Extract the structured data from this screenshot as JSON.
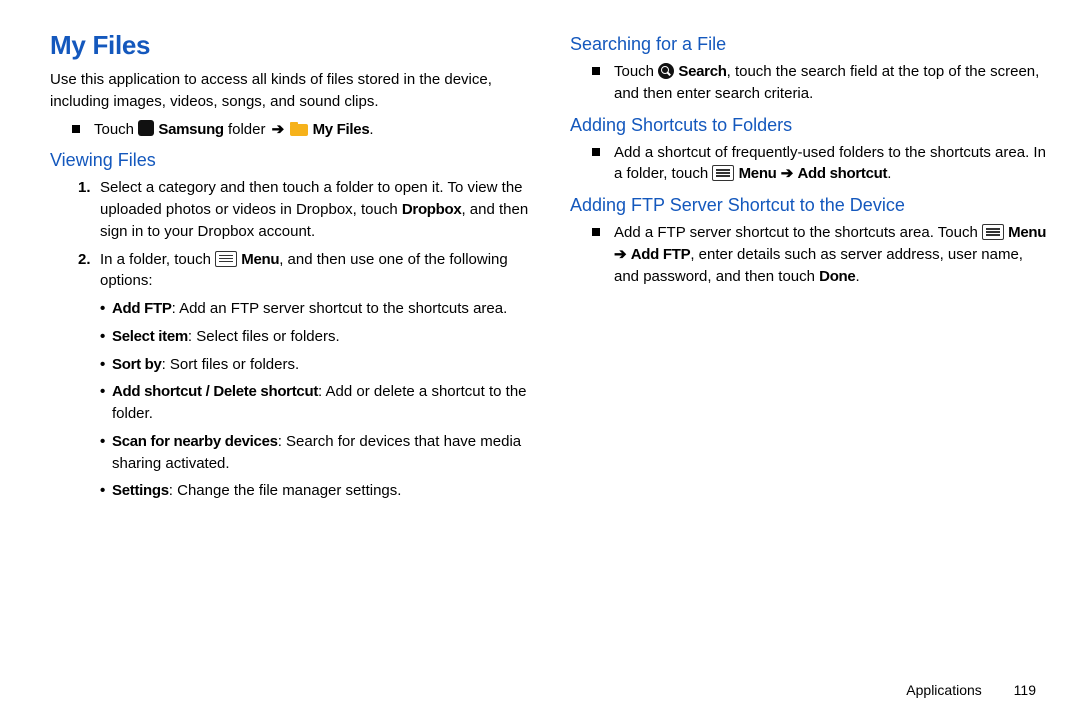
{
  "title": "My Files",
  "intro": "Use this application to access all kinds of files stored in the device, including images, videos, songs, and sound clips.",
  "nav": {
    "touch": "Touch ",
    "samsung": "Samsung",
    "folder": " folder ",
    "arrow": "➔",
    "myfiles": "My Files",
    "period": "."
  },
  "sec1": {
    "heading": "Viewing Files",
    "item1a": "Select a category and then touch a folder to open it. To view the uploaded photos or videos in Dropbox, touch ",
    "item1b": "Dropbox",
    "item1c": ", and then sign in to your Dropbox account.",
    "item2a": "In a folder, touch ",
    "item2menu": "Menu",
    "item2b": ", and then use one of the following options:",
    "opts": [
      {
        "b": "Add FTP",
        "t": ": Add an FTP server shortcut to the shortcuts area."
      },
      {
        "b": "Select item",
        "t": ": Select files or folders."
      },
      {
        "b": "Sort by",
        "t": ": Sort files or folders."
      },
      {
        "b": "Add shortcut / Delete shortcut",
        "t": ": Add or delete a shortcut to the folder."
      },
      {
        "b": "Scan for nearby devices",
        "t": ": Search for devices that have media sharing activated."
      },
      {
        "b": "Settings",
        "t": ": Change the file manager settings."
      }
    ]
  },
  "sec2": {
    "heading": "Searching for a File",
    "a": "Touch ",
    "search": "Search",
    "b": ", touch the search field at the top of the screen, and then enter search criteria."
  },
  "sec3": {
    "heading": "Adding Shortcuts to Folders",
    "a": "Add a shortcut of frequently-used folders to the shortcuts area. In a folder, touch ",
    "menu": "Menu",
    "arrow": " ➔ ",
    "addshortcut": "Add shortcut",
    "period": "."
  },
  "sec4": {
    "heading": "Adding FTP Server Shortcut to the Device",
    "a": "Add a FTP server shortcut to the shortcuts area. Touch ",
    "menu": "Menu",
    "arrow": " ➔ ",
    "addftp": "Add FTP",
    "b": ", enter details such as server address, user name, and password, and then touch ",
    "done": "Done",
    "period": "."
  },
  "footer": {
    "section": "Applications",
    "page": "119"
  }
}
